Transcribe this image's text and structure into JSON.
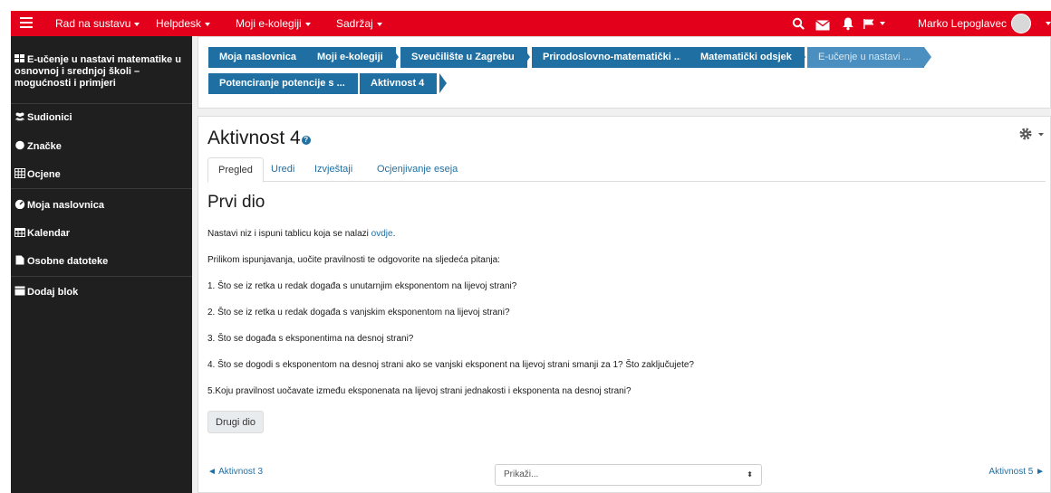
{
  "navbar": {
    "items": [
      "Rad na sustavu",
      "Helpdesk",
      "Moji e-kolegiji",
      "Sadržaj"
    ],
    "user_name": "Marko Lepoglavec",
    "bg_color": "#e2001a"
  },
  "sidebar": {
    "course_title": "E-učenje u nastavi matematike u osnovnoj i srednjoj školi – mogućnosti i primjeri",
    "items": [
      "Sudionici",
      "Značke",
      "Ocjene",
      "Moja naslovnica",
      "Kalendar",
      "Osobne datoteke",
      "Dodaj blok"
    ],
    "icons": [
      "users-icon",
      "badge-icon",
      "grid-icon",
      "dashboard-icon",
      "calendar-icon",
      "file-icon",
      "add-block-icon"
    ]
  },
  "breadcrumb": {
    "row1": [
      "Moja naslovnica",
      "Moji e-kolegiji",
      "Sveučilište u Zagrebu",
      "Prirodoslovno-matematički ...",
      "Matematički odsjek",
      "E-učenje u nastavi ..."
    ],
    "row2": [
      "Potenciranje potencije s ...",
      "Aktivnost 4"
    ],
    "color": "#1f6fa3"
  },
  "page": {
    "title": "Aktivnost 4",
    "tabs": [
      "Pregled",
      "Uredi",
      "Izvještaji",
      "Ocjenjivanje eseja"
    ],
    "active_tab": "Pregled",
    "section_heading": "Prvi dio",
    "intro_text": "Nastavi niz i ispuni tablicu koja se nalazi ",
    "intro_link": "ovdje",
    "intro_end": ".",
    "instruction": "Prilikom ispunjavanja, uočite pravilnosti te odgovorite na sljedeća pitanja:",
    "questions": [
      "1. Što se iz retka u redak događa s unutarnjim eksponentom na lijevoj strani?",
      "2. Što se iz retka u redak događa s vanjskim eksponentom na lijevoj strani?",
      "3. Što se događa s eksponentima na desnoj strani?",
      "4. Što se dogodi s eksponentom na desnoj strani ako se vanjski eksponent na lijevoj strani smanji za 1? Što zaključujete?",
      "5.Koju pravilnost uočavate između eksponenata na lijevoj strani jednakosti i eksponenta na desnoj strani?"
    ],
    "next_section_button": "Drugi dio",
    "prev_activity": "◄ Aktivnost 3",
    "jump_placeholder": "Prikaži...",
    "next_activity": "Aktivnost 5 ►"
  }
}
